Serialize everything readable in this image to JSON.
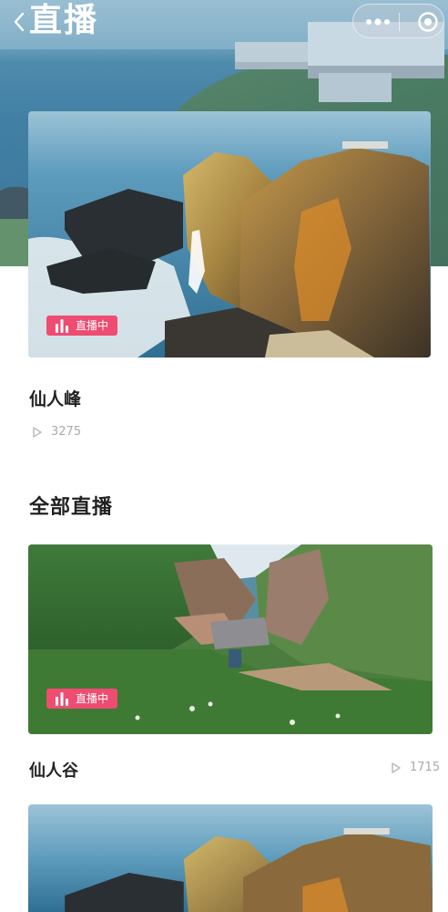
{
  "header": {
    "title": "直播",
    "icons": {
      "back": "chevron-left-icon",
      "more": "more-dots-icon",
      "close": "target-close-icon"
    }
  },
  "featured": {
    "name": "仙人峰",
    "views": "3275",
    "badge": "直播中"
  },
  "all_live": {
    "section_title": "全部直播",
    "items": [
      {
        "name": "仙人谷",
        "views": "1715",
        "badge": "直播中"
      }
    ]
  },
  "colors": {
    "accent": "#ef4c72",
    "title_text": "#222222",
    "muted_text": "#aaaaaa"
  }
}
